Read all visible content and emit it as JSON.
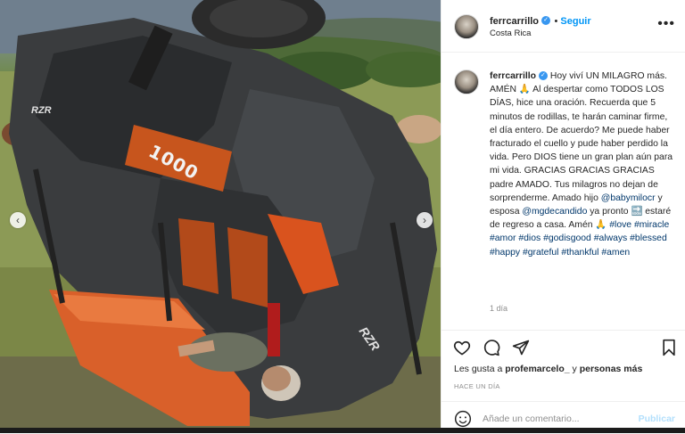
{
  "post": {
    "username": "ferrcarrillo",
    "follow_label": "Seguir",
    "location": "Costa Rica",
    "more_label": "•••",
    "verified_glyph": "✓",
    "caption_text": "Hoy viví UN MILAGRO más. AMÉN 🙏 Al despertar como TODOS LOS DÍAS, hice una oración. Recuerda que 5 minutos de rodillas, te harán caminar firme, el día entero. De acuerdo? Me puede haber fracturado el cuello y pude haber perdido la vida. Pero DIOS tiene un gran plan aún para mi vida. GRACIAS GRACIAS GRACIAS padre AMADO. Tus milagros no dejan de sorprenderme. Amado hijo ",
    "mention1": "@babymilocr",
    "caption_mid1": " y esposa ",
    "mention2": "@mgdecandido",
    "caption_mid2": " ya pronto 🔜 estaré de regreso a casa. Amén 🙏 ",
    "hashtags": [
      "#love",
      "#miracle",
      "#amor",
      "#dios",
      "#godisgood",
      "#always",
      "#blessed",
      "#happy",
      "#grateful",
      "#thankful",
      "#amen"
    ],
    "posted_ago": "1 día",
    "likes_prefix": "Les gusta a ",
    "likes_user": "profemarcelo_",
    "likes_suffix": " y ",
    "likes_more": "personas más",
    "timestamp": "HACE UN DÍA",
    "comment_placeholder": "Añade un comentario...",
    "publish_label": "Publicar"
  },
  "photo": {
    "vehicle_brand": "RZR",
    "vehicle_model": "1000",
    "prev_arrow": "‹",
    "next_arrow": "›"
  },
  "icons": {
    "heart": "heart-icon",
    "comment": "comment-icon",
    "share": "share-icon",
    "save": "bookmark-icon",
    "emoji": "emoji-icon"
  },
  "colors": {
    "link_blue": "#0095f6",
    "tag_blue": "#00376b",
    "vehicle_orange": "#d9531e",
    "vehicle_gray": "#3a3c3e"
  }
}
